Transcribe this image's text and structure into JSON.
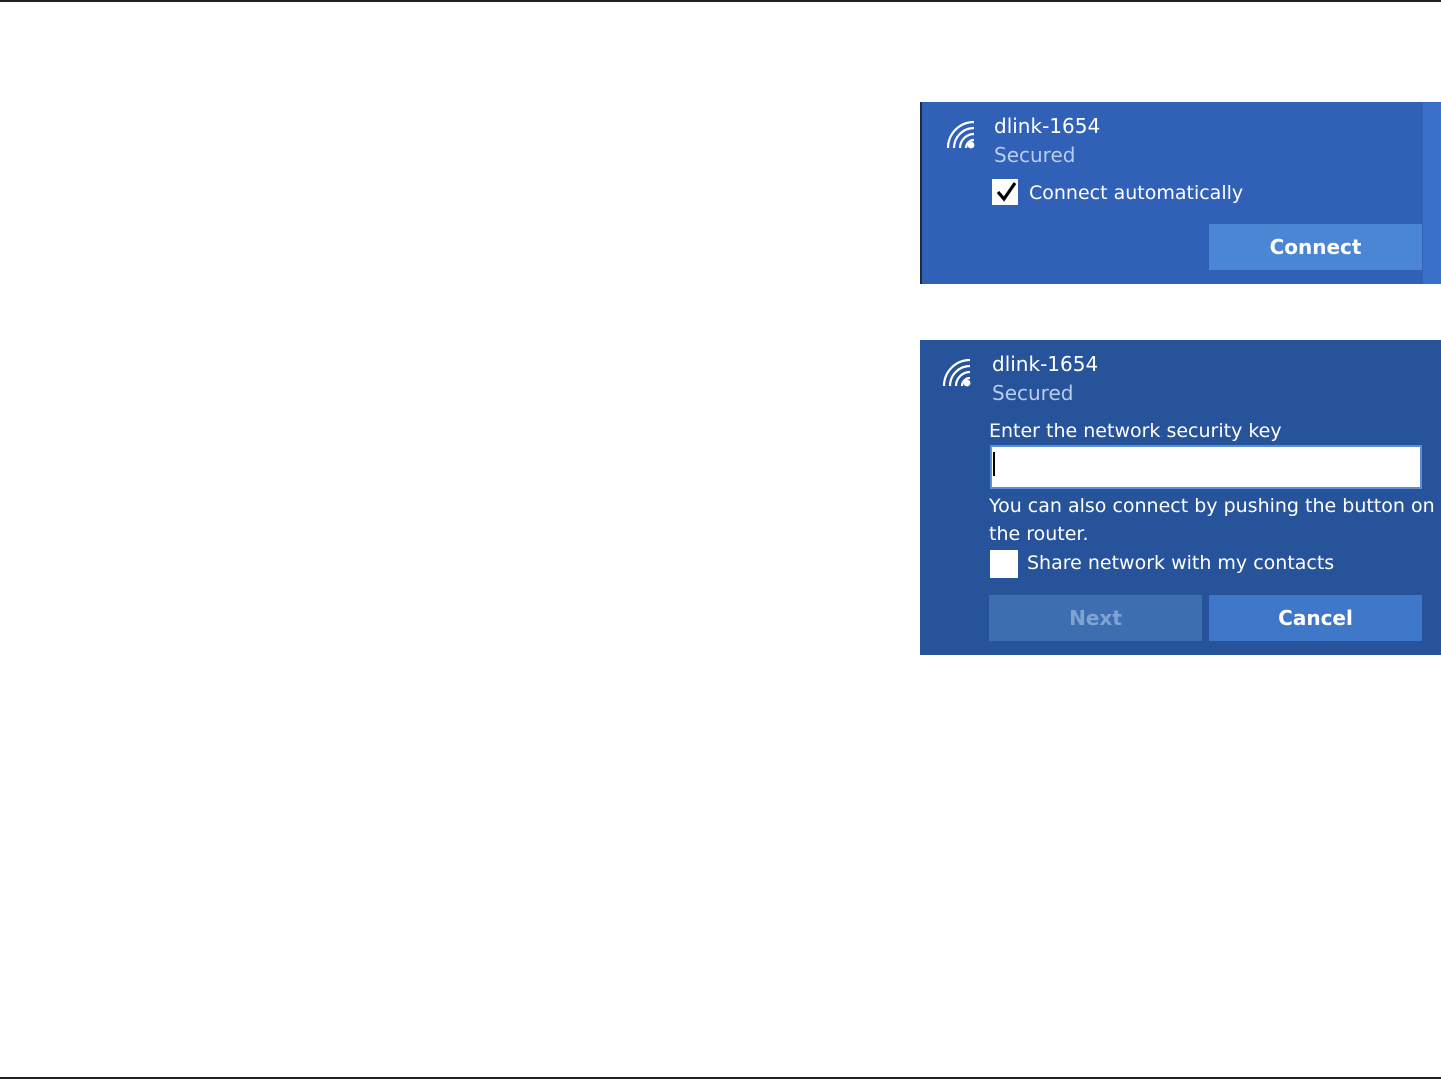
{
  "connect_panel": {
    "ssid": "dlink-1654",
    "status": "Secured",
    "auto_connect_label": "Connect automatically",
    "auto_connect_checked": true,
    "connect_button": "Connect"
  },
  "key_panel": {
    "ssid": "dlink-1654",
    "status": "Secured",
    "key_prompt": "Enter the network security key",
    "key_value": "",
    "wps_hint_line1": "You can also connect by pushing the button on",
    "wps_hint_line2": "the router.",
    "share_label": "Share network with my contacts",
    "share_checked": false,
    "next_button": "Next",
    "cancel_button": "Cancel"
  },
  "colors": {
    "panel_connect_bg": "#3061b7",
    "panel_key_bg": "#26539a",
    "button_primary": "#4a86d4",
    "status_text": "#b8cdee"
  }
}
